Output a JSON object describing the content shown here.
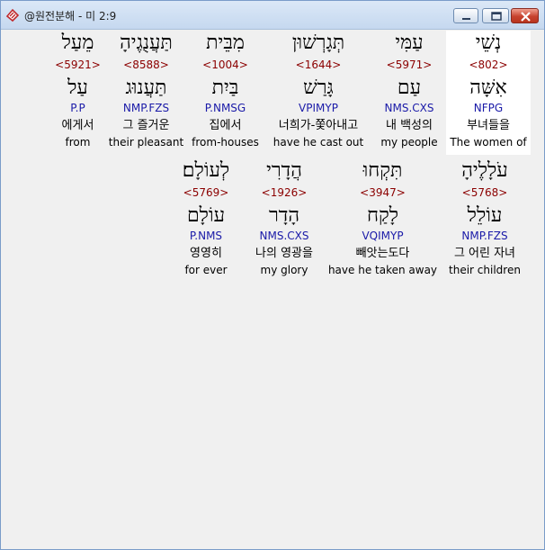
{
  "window": {
    "title": "@원전분해 - 미 2:9",
    "icon": "app-logo-icon",
    "buttons": [
      "minimize-icon",
      "maximize-icon",
      "close-icon"
    ]
  },
  "rows": [
    {
      "words": [
        {
          "heb": "נְשֵׁי",
          "strong": "<802>",
          "root": "אִשָּׁה",
          "parse": "NFPG",
          "ko": "부녀들을",
          "en": "The women of",
          "highlighted": true
        },
        {
          "heb": "עַמִּי",
          "strong": "<5971>",
          "root": "עַם",
          "parse": "NMS.CXS",
          "ko": "내 백성의",
          "en": "my people",
          "highlighted": false
        },
        {
          "heb": "תְּגָרְשׁוּן",
          "strong": "<1644>",
          "root": "גָּרַשׁ",
          "parse": "VPIMYP",
          "ko": "너희가-쫓아내고",
          "en": "have he cast out",
          "highlighted": false
        },
        {
          "heb": "מִבֵּית",
          "strong": "<1004>",
          "root": "בַּיִת",
          "parse": "P.NMSG",
          "ko": "집에서",
          "en": "from-houses",
          "highlighted": false
        },
        {
          "heb": "תַּעֲנֻגֶיהָ",
          "strong": "<8588>",
          "root": "תַּעֲנוּג",
          "parse": "NMP.FZS",
          "ko": "그 즐거운",
          "en": "their pleasant",
          "highlighted": false
        },
        {
          "heb": "מֵעַל",
          "strong": "<5921>",
          "root": "עַל",
          "parse": "P.P",
          "ko": "에게서",
          "en": "from",
          "highlighted": false
        }
      ]
    },
    {
      "words": [
        {
          "heb": "עֹלָלֶיהָ",
          "strong": "<5768>",
          "root": "עוֹלֵל",
          "parse": "NMP.FZS",
          "ko": "그 어린 자녀",
          "en": "their children",
          "highlighted": false
        },
        {
          "heb": "תִּקְחוּ",
          "strong": "<3947>",
          "root": "לָקַח",
          "parse": "VQIMYP",
          "ko": "빼앗는도다",
          "en": "have he taken away",
          "highlighted": false
        },
        {
          "heb": "הֲדָרִי",
          "strong": "<1926>",
          "root": "הָדָר",
          "parse": "NMS.CXS",
          "ko": "나의 영광을",
          "en": "my glory",
          "highlighted": false
        },
        {
          "heb": "לְעוֹלָם׃",
          "strong": "<5769>",
          "root": "עוֹלָם",
          "parse": "P.NMS",
          "ko": "영영히",
          "en": "for ever",
          "highlighted": false
        }
      ]
    }
  ]
}
